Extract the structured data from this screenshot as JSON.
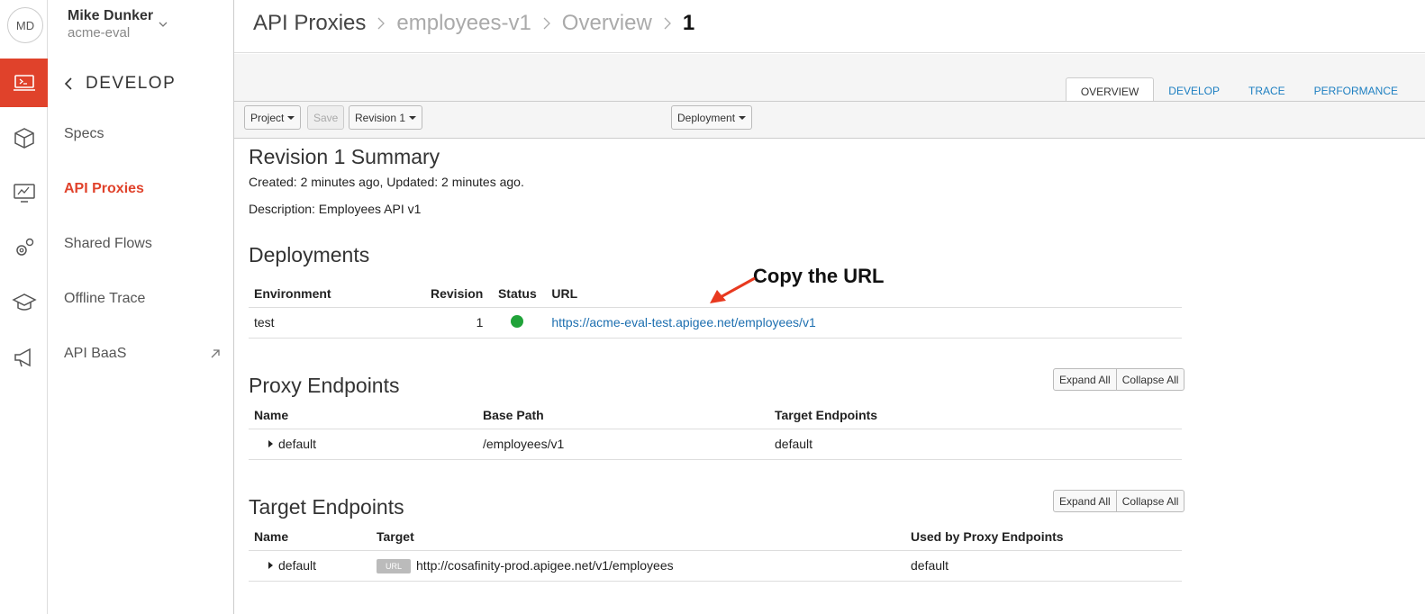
{
  "user": {
    "initials": "MD",
    "name": "Mike Dunker",
    "org": "acme-eval"
  },
  "rail": [
    "develop-icon",
    "package-icon",
    "monitor-icon",
    "gears-icon",
    "graduation-cap-icon",
    "megaphone-icon"
  ],
  "nav": {
    "section": "DEVELOP",
    "items": [
      "Specs",
      "API Proxies",
      "Shared Flows",
      "Offline Trace",
      "API BaaS"
    ],
    "active": "API Proxies"
  },
  "breadcrumb": [
    "API Proxies",
    "employees-v1",
    "Overview",
    "1"
  ],
  "tabs": [
    "OVERVIEW",
    "DEVELOP",
    "TRACE",
    "PERFORMANCE"
  ],
  "toolbar": {
    "project": "Project",
    "save": "Save",
    "revision": "Revision 1",
    "deployment": "Deployment"
  },
  "summary": {
    "title": "Revision 1 Summary",
    "created": "Created: 2 minutes ago, Updated: 2 minutes ago.",
    "description": "Description: Employees API v1"
  },
  "deployments": {
    "title": "Deployments",
    "headers": [
      "Environment",
      "Revision",
      "Status",
      "URL"
    ],
    "rows": [
      {
        "env": "test",
        "revision": "1",
        "url": "https://acme-eval-test.apigee.net/employees/v1"
      }
    ]
  },
  "proxy_endpoints": {
    "title": "Proxy Endpoints",
    "expand": "Expand All",
    "collapse": "Collapse All",
    "headers": [
      "Name",
      "Base Path",
      "Target Endpoints"
    ],
    "rows": [
      {
        "name": "default",
        "base_path": "/employees/v1",
        "targets": "default"
      }
    ]
  },
  "target_endpoints": {
    "title": "Target Endpoints",
    "expand": "Expand All",
    "collapse": "Collapse All",
    "headers": [
      "Name",
      "Target",
      "Used by Proxy Endpoints"
    ],
    "rows": [
      {
        "name": "default",
        "badge": "URL",
        "target": "http://cosafinity-prod.apigee.net/v1/employees",
        "used_by": "default"
      }
    ]
  },
  "annotation": "Copy the URL",
  "colors": {
    "accent": "#e0422b",
    "link": "#1d7fc1",
    "status_ok": "#20a339"
  }
}
